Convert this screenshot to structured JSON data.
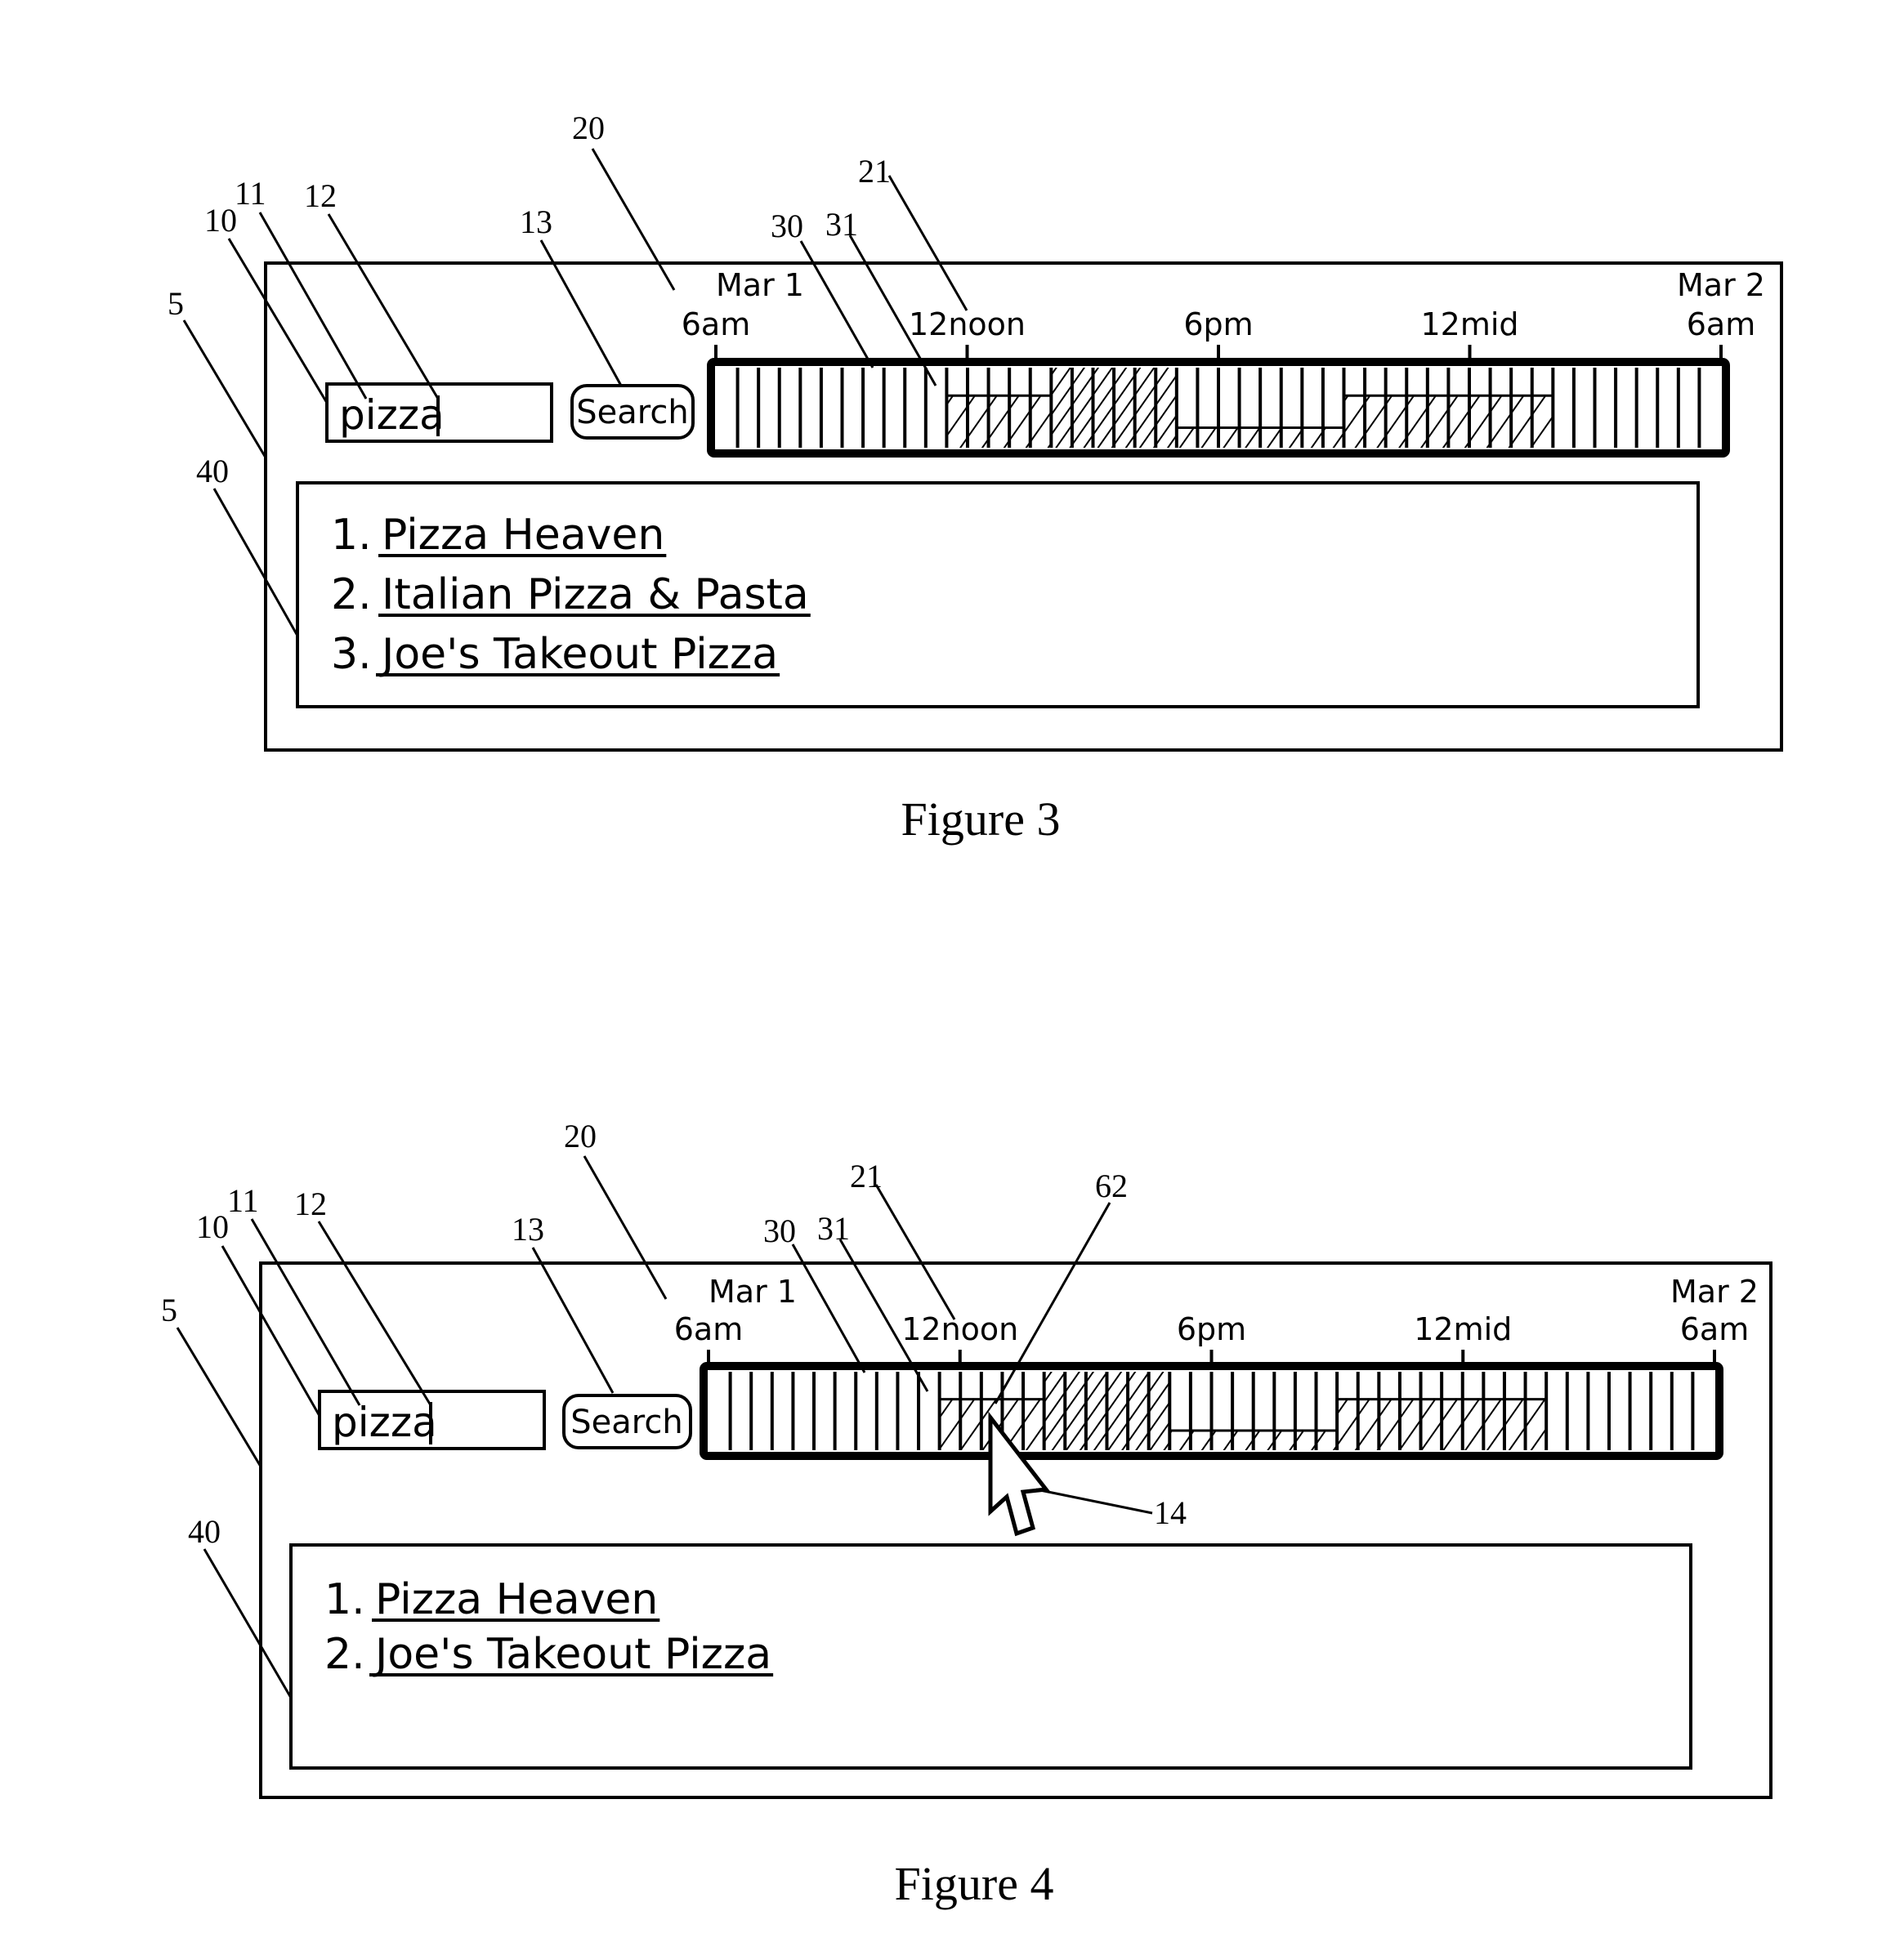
{
  "figures": [
    {
      "id": "fig3",
      "caption": "Figure 3",
      "search": {
        "value": "pizza",
        "button_label": "Search"
      },
      "timeline": {
        "start_label": [
          "Mar 1",
          "6am"
        ],
        "end_label": [
          "Mar 2",
          "6am"
        ],
        "ticks": [
          "12noon",
          "6pm",
          "12mid"
        ],
        "hours_span": 24,
        "bin_minutes": 30,
        "bins": [
          0,
          0,
          0,
          0,
          0,
          0,
          0,
          0,
          0,
          0,
          0,
          0.65,
          0.65,
          0.65,
          0.65,
          0.65,
          1,
          1,
          1,
          1,
          1,
          1,
          0.25,
          0.25,
          0.25,
          0.25,
          0.25,
          0.25,
          0.25,
          0.25,
          0.65,
          0.65,
          0.65,
          0.65,
          0.65,
          0.65,
          0.65,
          0.65,
          0.65,
          0.65,
          0,
          0,
          0,
          0,
          0,
          0,
          0,
          0
        ]
      },
      "results": [
        "Pizza Heaven",
        "Italian Pizza & Pasta",
        "Joe's Takeout Pizza"
      ],
      "reference_numerals": {
        "window": "5",
        "search_field": "10",
        "query_text": "11",
        "text_cursor": "12",
        "search_button": "13",
        "timeline": "20",
        "time_labels": "21",
        "time_bin": "30",
        "density_fill": "31",
        "results_list": "40"
      },
      "cursor": null
    },
    {
      "id": "fig4",
      "caption": "Figure 4",
      "search": {
        "value": "pizza",
        "button_label": "Search"
      },
      "timeline": {
        "start_label": [
          "Mar 1",
          "6am"
        ],
        "end_label": [
          "Mar 2",
          "6am"
        ],
        "ticks": [
          "12noon",
          "6pm",
          "12mid"
        ],
        "hours_span": 24,
        "bin_minutes": 30,
        "bins": [
          0,
          0,
          0,
          0,
          0,
          0,
          0,
          0,
          0,
          0,
          0,
          0.65,
          0.65,
          0.65,
          0.65,
          0.65,
          1,
          1,
          1,
          1,
          1,
          1,
          0.25,
          0.25,
          0.25,
          0.25,
          0.25,
          0.25,
          0.25,
          0.25,
          0.65,
          0.65,
          0.65,
          0.65,
          0.65,
          0.65,
          0.65,
          0.65,
          0.65,
          0.65,
          0,
          0,
          0,
          0,
          0,
          0,
          0,
          0
        ],
        "hovered_bin": 12
      },
      "results": [
        "Pizza Heaven",
        "Joe's Takeout Pizza"
      ],
      "reference_numerals": {
        "window": "5",
        "search_field": "10",
        "query_text": "11",
        "text_cursor": "12",
        "search_button": "13",
        "pointer": "14",
        "timeline": "20",
        "time_labels": "21",
        "time_bin": "30",
        "density_fill": "31",
        "results_list": "40",
        "selected_bin": "62"
      },
      "cursor": "arrow-pointer-icon"
    }
  ]
}
